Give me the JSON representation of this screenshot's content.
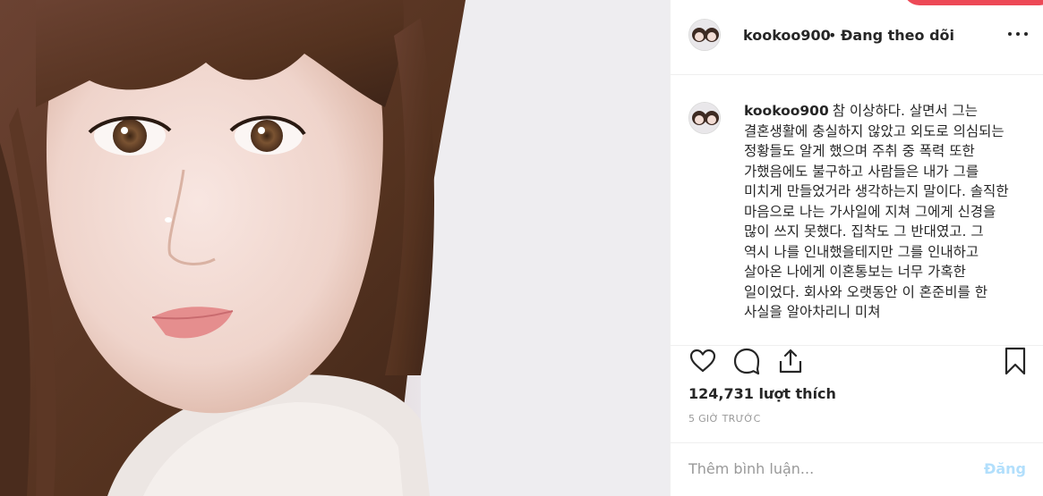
{
  "post": {
    "photo_alt": "Portrait photo",
    "username": "kookoo900",
    "separator": "•",
    "follow_status": "Đang theo dõi",
    "caption": "참 이상하다. 살면서 그는 결혼생활에 충실하지 않았고 외도로 의심되는 정황들도 알게 했으며 주취 중 폭력 또한 가했음에도 불구하고 사람들은 내가 그를 미치게 만들었거라 생각하는지 말이다. 솔직한 마음으로 나는 가사일에 지쳐 그에게 신경을 많이 쓰지 못했다. 집착도 그 반대였고. 그 역시 나를 인내했을테지만 그를 인내하고 살아온 나에게 이혼통보는 너무 가혹한 일이었다. 회사와 오랫동안 이 혼준비를 한 사실을 알아차리니 미쳐",
    "likes": "124,731 lượt thích",
    "time": "5 GIỜ TRƯỚC"
  },
  "comment": {
    "placeholder": "Thêm bình luận...",
    "post_label": "Đăng"
  },
  "icons": {
    "like": "heart-icon",
    "comment": "comment-icon",
    "share": "share-icon",
    "save": "bookmark-icon",
    "more": "more-options-icon"
  },
  "colors": {
    "accent_red": "#ed4956",
    "post_button_disabled": "#b2dffc",
    "muted_text": "#999999",
    "border": "#efefef"
  }
}
